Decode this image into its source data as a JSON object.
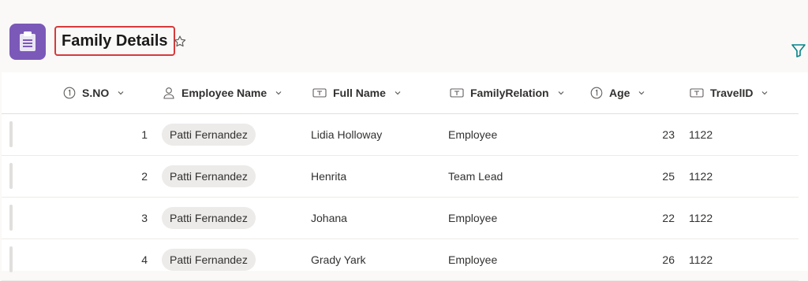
{
  "header": {
    "title": "Family Details",
    "app_icon": "clipboard-icon",
    "favorite_icon": "star-icon",
    "filter_icon": "filter-icon"
  },
  "columns": [
    {
      "label": "S.NO",
      "type_icon": "number-icon"
    },
    {
      "label": "Employee Name",
      "type_icon": "person-icon"
    },
    {
      "label": "Full Name",
      "type_icon": "text-icon"
    },
    {
      "label": "FamilyRelation",
      "type_icon": "text-icon"
    },
    {
      "label": "Age",
      "type_icon": "number-icon"
    },
    {
      "label": "TravelID",
      "type_icon": "text-icon"
    }
  ],
  "rows": [
    {
      "sno": "1",
      "employee": "Patti Fernandez",
      "full_name": "Lidia Holloway",
      "relation": "Employee",
      "age": "23",
      "travel_id": "1122"
    },
    {
      "sno": "2",
      "employee": "Patti Fernandez",
      "full_name": "Henrita",
      "relation": "Team Lead",
      "age": "25",
      "travel_id": "1122"
    },
    {
      "sno": "3",
      "employee": "Patti Fernandez",
      "full_name": "Johana",
      "relation": "Employee",
      "age": "22",
      "travel_id": "1122"
    },
    {
      "sno": "4",
      "employee": "Patti Fernandez",
      "full_name": "Grady Yark",
      "relation": "Employee",
      "age": "26",
      "travel_id": "1122"
    }
  ],
  "colors": {
    "app_icon_bg": "#7b59b8",
    "title_highlight": "#d63a3a",
    "filter_accent": "#038387"
  }
}
